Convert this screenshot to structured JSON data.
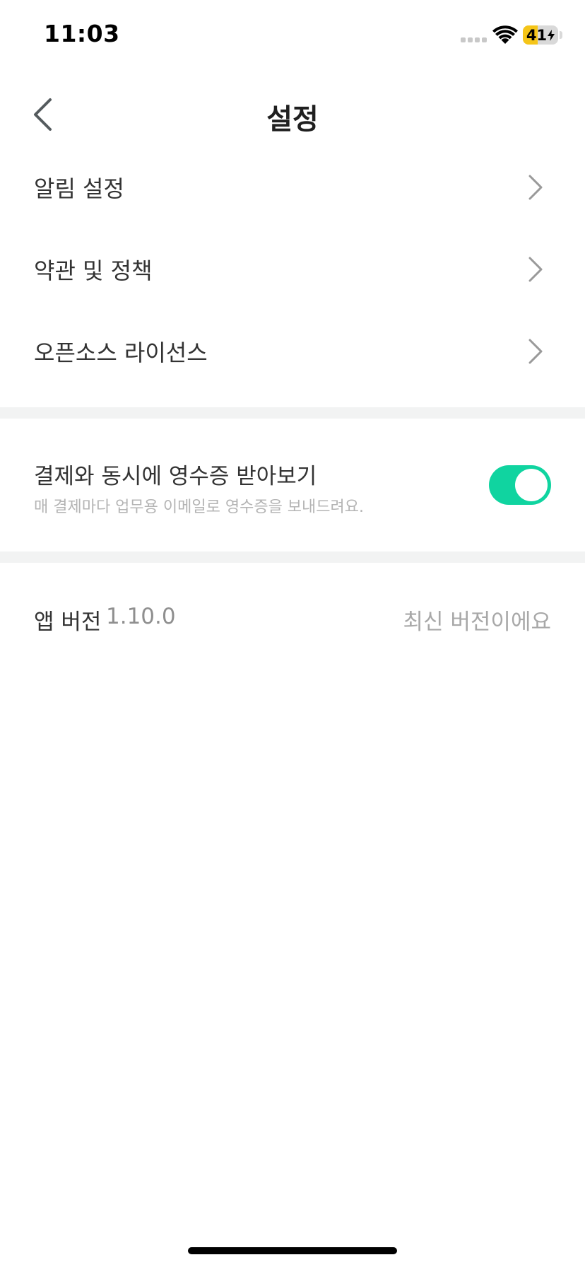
{
  "status_bar": {
    "time": "11:03",
    "battery_level": "41",
    "battery_fraction": 0.41,
    "charging": true,
    "icons": [
      "signal-dots-icon",
      "wifi-icon",
      "battery-charging-icon"
    ]
  },
  "header": {
    "title": "설정",
    "back_icon": "chevron-left-icon"
  },
  "menu": {
    "items": [
      {
        "label": "알림 설정",
        "icon": "chevron-right-icon"
      },
      {
        "label": "약관 및 정책",
        "icon": "chevron-right-icon"
      },
      {
        "label": "오픈소스 라이선스",
        "icon": "chevron-right-icon"
      }
    ]
  },
  "receipt_setting": {
    "title": "결제와 동시에 영수증 받아보기",
    "description": "매 결제마다 업무용 이메일로 영수증을 보내드려요.",
    "enabled": true
  },
  "app_version": {
    "label": "앱 버전",
    "version": "1.10.0",
    "status": "최신 버전이에요"
  },
  "colors": {
    "accent": "#10d4a0",
    "divider": "#f2f3f3",
    "battery": "#f5c518"
  }
}
